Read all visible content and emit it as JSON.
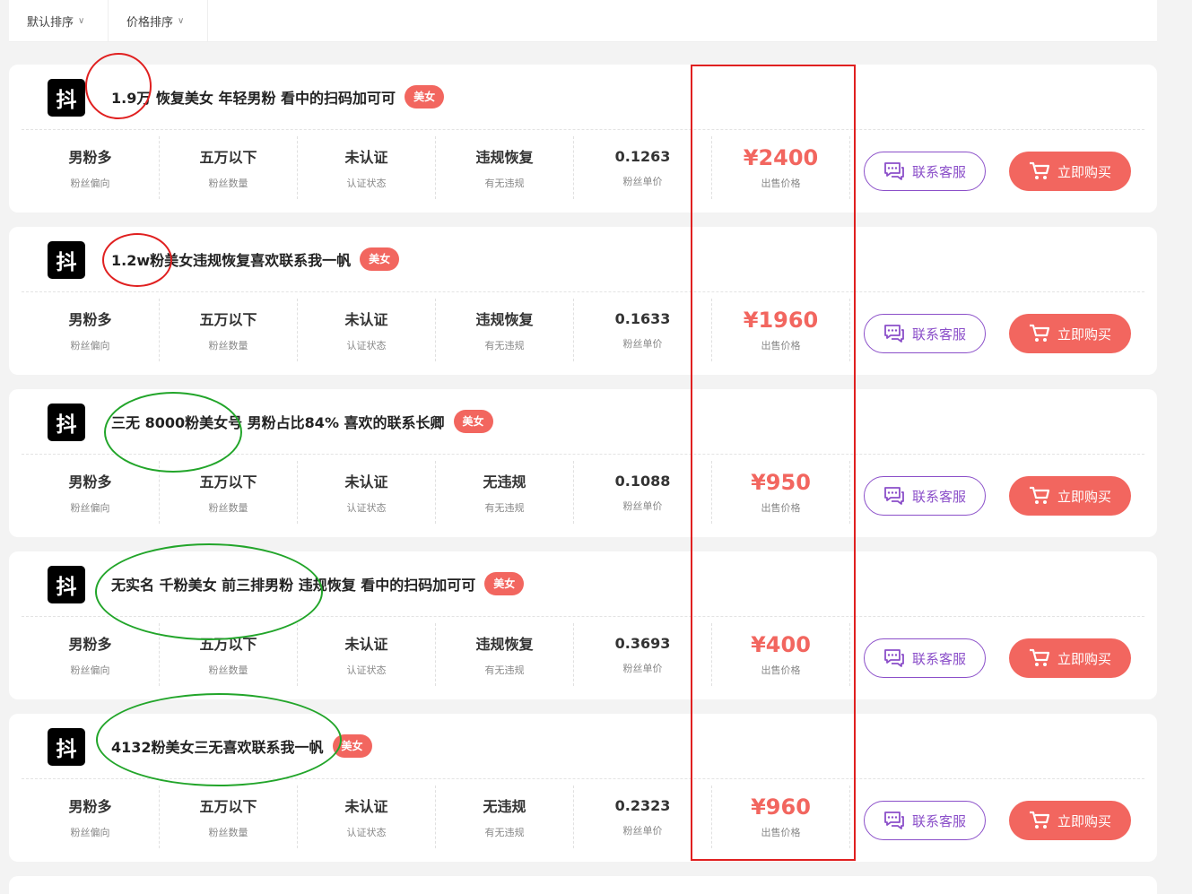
{
  "sort": {
    "default_label": "默认排序",
    "price_label": "价格排序",
    "chevron": "∨"
  },
  "labels": {
    "fan_bias": "粉丝偏向",
    "fan_count": "粉丝数量",
    "cert_status": "认证状态",
    "violation": "有无违规",
    "unit_price": "粉丝单价",
    "sale_price": "出售价格",
    "service_btn": "联系客服",
    "buy_btn": "立即购买"
  },
  "logo_glyph": "抖",
  "colors": {
    "accent": "#f2665f",
    "service": "#8b4fc9",
    "annot_red": "#e02020",
    "annot_green": "#22a52a"
  },
  "listings": [
    {
      "title": "1.9万 恢复美女 年轻男粉 看中的扫码加可可",
      "tag": "美女",
      "fan_bias": "男粉多",
      "fan_count": "五万以下",
      "cert": "未认证",
      "violation": "违规恢复",
      "unit_price": "0.1263",
      "price": "¥2400"
    },
    {
      "title": "1.2w粉美女违规恢复喜欢联系我一帆",
      "tag": "美女",
      "fan_bias": "男粉多",
      "fan_count": "五万以下",
      "cert": "未认证",
      "violation": "违规恢复",
      "unit_price": "0.1633",
      "price": "¥1960"
    },
    {
      "title": "三无 8000粉美女号 男粉占比84% 喜欢的联系长卿",
      "tag": "美女",
      "fan_bias": "男粉多",
      "fan_count": "五万以下",
      "cert": "未认证",
      "violation": "无违规",
      "unit_price": "0.1088",
      "price": "¥950"
    },
    {
      "title": "无实名 千粉美女 前三排男粉 违规恢复 看中的扫码加可可",
      "tag": "美女",
      "fan_bias": "男粉多",
      "fan_count": "五万以下",
      "cert": "未认证",
      "violation": "违规恢复",
      "unit_price": "0.3693",
      "price": "¥400"
    },
    {
      "title": "4132粉美女三无喜欢联系我一帆",
      "tag": "美女",
      "fan_bias": "男粉多",
      "fan_count": "五万以下",
      "cert": "未认证",
      "violation": "无违规",
      "unit_price": "0.2323",
      "price": "¥960"
    }
  ]
}
